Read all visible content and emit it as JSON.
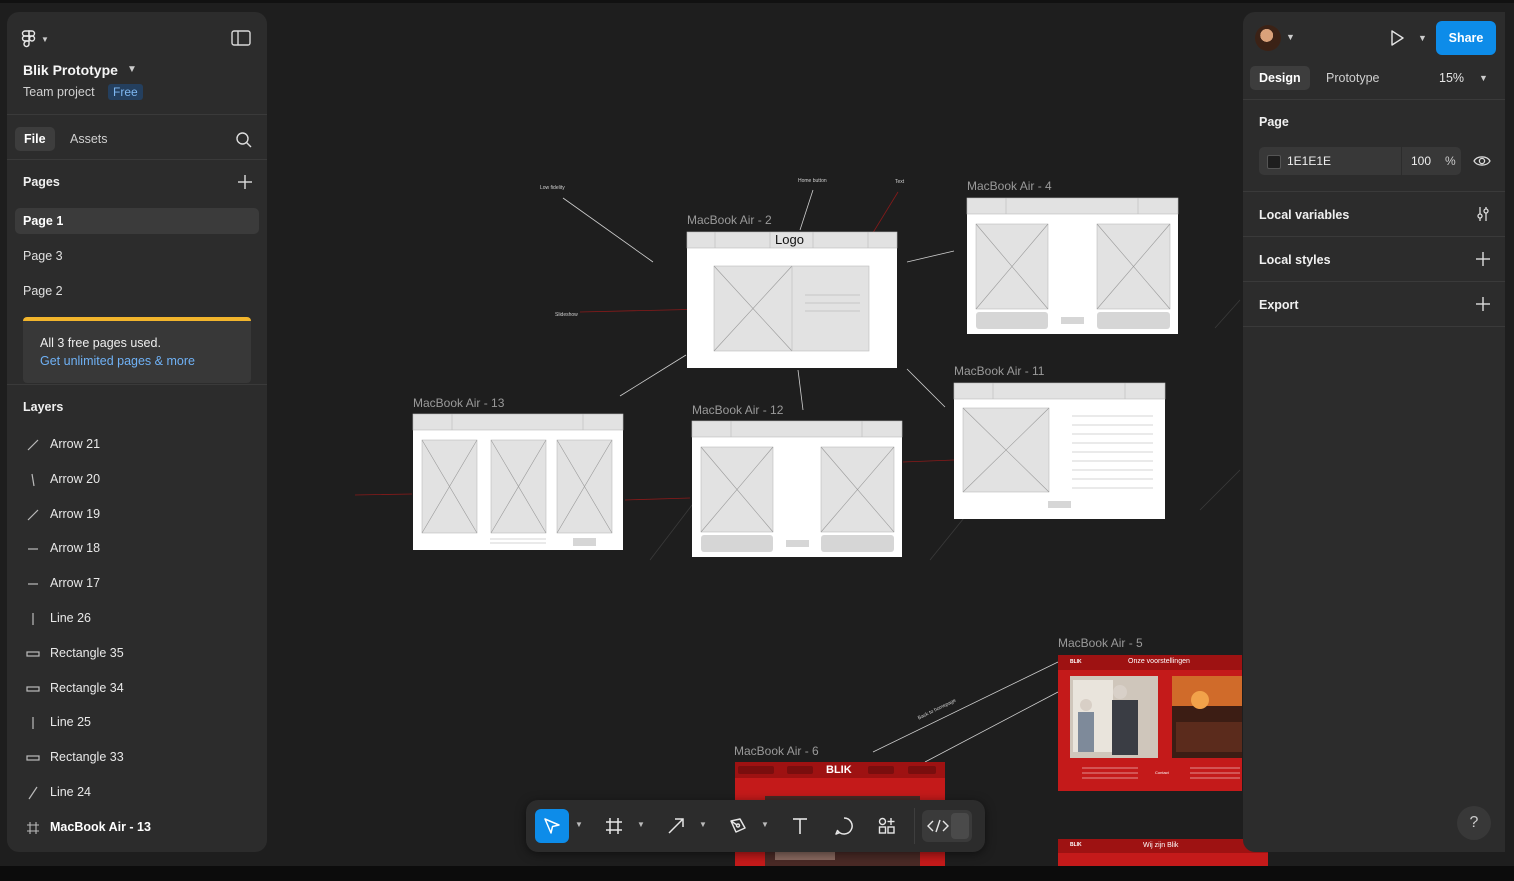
{
  "app": {
    "project_name": "Blik Prototype",
    "team": "Team project",
    "plan_badge": "Free"
  },
  "left_tabs": {
    "file": "File",
    "assets": "Assets"
  },
  "pages": {
    "title": "Pages",
    "items": [
      {
        "label": "Page 1",
        "active": true
      },
      {
        "label": "Page 3",
        "active": false
      },
      {
        "label": "Page 2",
        "active": false
      }
    ],
    "upsell": {
      "line1": "All 3 free pages used.",
      "line2": "Get unlimited pages & more"
    }
  },
  "layers": {
    "title": "Layers",
    "items": [
      {
        "label": "Arrow 21",
        "icon": "arrow-diagonal-icon"
      },
      {
        "label": "Arrow 20",
        "icon": "arrow-vertical-icon"
      },
      {
        "label": "Arrow 19",
        "icon": "arrow-diagonal-icon"
      },
      {
        "label": "Arrow 18",
        "icon": "arrow-horizontal-icon"
      },
      {
        "label": "Arrow 17",
        "icon": "arrow-horizontal-icon"
      },
      {
        "label": "Line 26",
        "icon": "line-vertical-icon"
      },
      {
        "label": "Rectangle 35",
        "icon": "rectangle-icon"
      },
      {
        "label": "Rectangle 34",
        "icon": "rectangle-icon"
      },
      {
        "label": "Line 25",
        "icon": "line-vertical-icon"
      },
      {
        "label": "Rectangle 33",
        "icon": "rectangle-icon"
      },
      {
        "label": "Line 24",
        "icon": "line-diagonal-icon"
      },
      {
        "label": "MacBook Air - 13",
        "icon": "frame-icon"
      }
    ]
  },
  "right_panel": {
    "share": "Share",
    "tabs": {
      "design": "Design",
      "prototype": "Prototype"
    },
    "zoom": "15%",
    "page_section": "Page",
    "bg_hex": "1E1E1E",
    "bg_opacity": "100",
    "percent": "%",
    "local_variables": "Local variables",
    "local_styles": "Local styles",
    "export": "Export",
    "help": "?"
  },
  "canvas": {
    "frames": {
      "f2": "MacBook Air - 2",
      "f4": "MacBook Air - 4",
      "f11": "MacBook Air - 11",
      "f12": "MacBook Air - 12",
      "f13": "MacBook Air - 13",
      "f5": "MacBook Air - 5",
      "f6": "MacBook Air - 6"
    },
    "logo_text": "Logo",
    "annotations": {
      "low_fidelity": "Low fidelity",
      "home_button": "Home button",
      "text": "Text",
      "slideshow": "Slideshow",
      "back_to_homepage": "Back to homepage"
    },
    "f5": {
      "brand": "BLIK",
      "heading": "Onze voorstellingen",
      "contact": "Contact"
    },
    "f6": {
      "brand": "BLIK"
    },
    "f_bottom": {
      "brand": "BLIK",
      "heading": "Wij zijn Blik"
    }
  },
  "colors": {
    "canvas_bg": "#1e1e1e",
    "panel_bg": "#2c2c2c",
    "accent_blue": "#0d8ce9",
    "warning_yellow": "#f2b52c",
    "brand_red": "#c41a1a"
  }
}
